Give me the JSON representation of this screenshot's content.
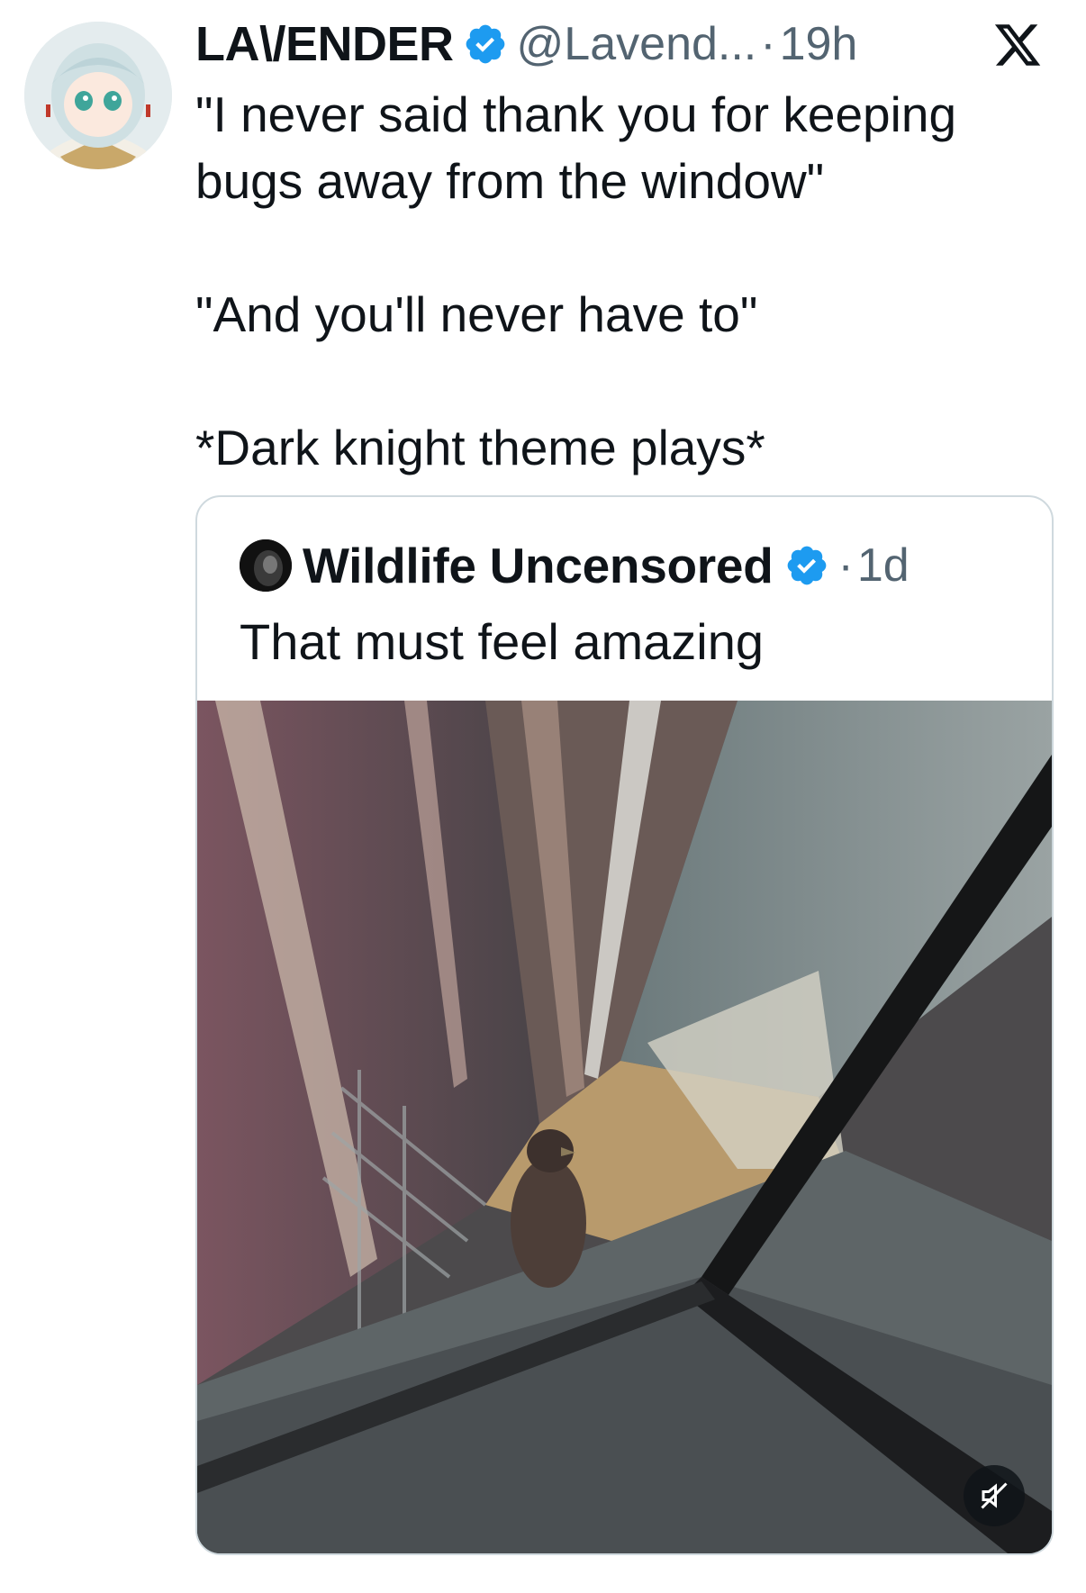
{
  "tweet": {
    "display_name": "LA\\/ENDER",
    "handle": "@Lavend...",
    "separator": "·",
    "time": "19h",
    "text": "\"I never said thank you for keeping bugs away from the window\"\n\n\"And you'll never have to\"\n\n*Dark knight theme plays*",
    "verified_icon": "verified-badge-icon",
    "platform_icon": "x-logo-icon"
  },
  "quote": {
    "display_name": "Wildlife Uncensored",
    "separator": "·",
    "time": "1d",
    "text": "That must feel amazing",
    "media_icon": "muted-speaker-icon"
  },
  "colors": {
    "verified": "#1d9bf0",
    "secondary_text": "#536471",
    "border": "#cfd9de"
  }
}
